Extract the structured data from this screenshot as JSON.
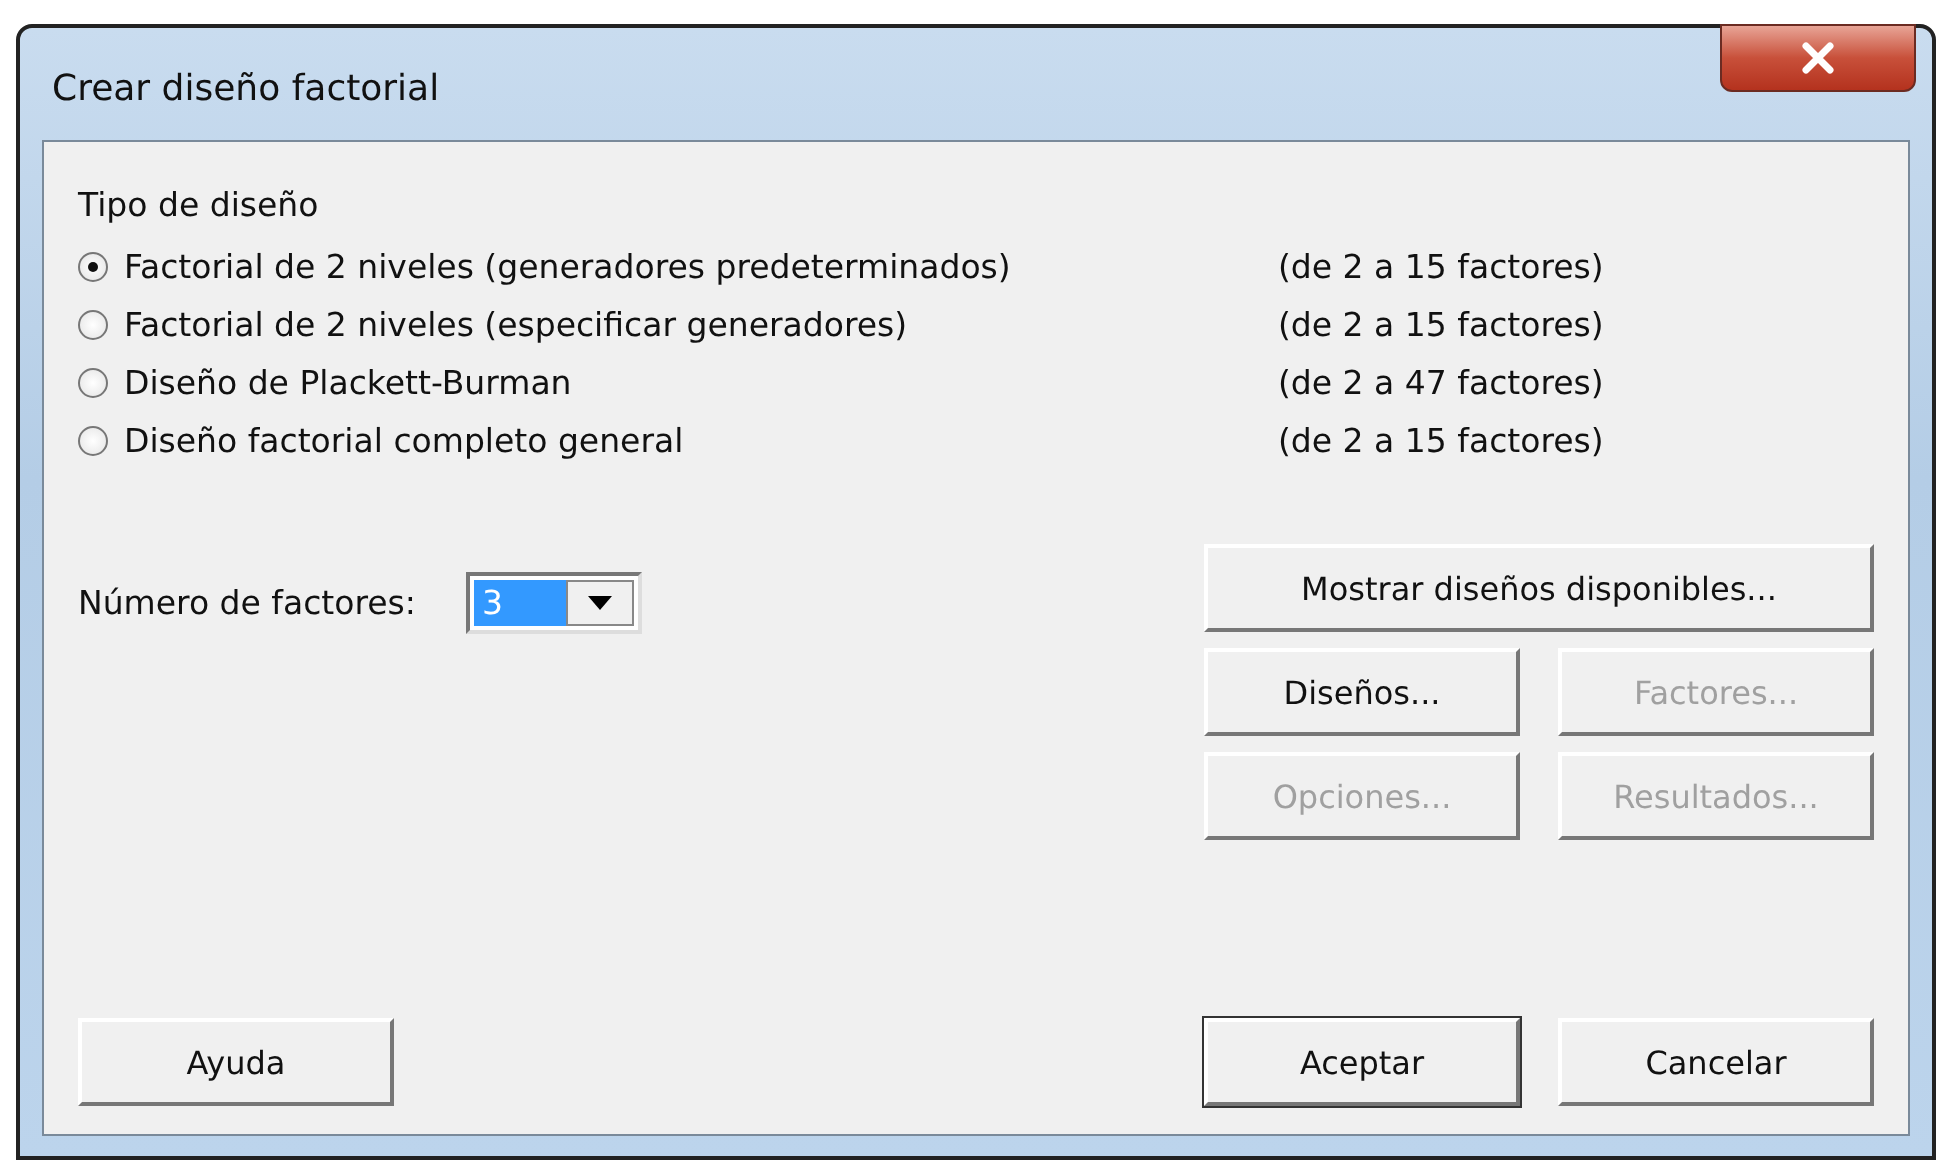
{
  "window": {
    "title": "Crear diseño factorial"
  },
  "design_type": {
    "label": "Tipo de diseño",
    "options": [
      {
        "label": "Factorial de 2 niveles (generadores predeterminados)",
        "range": "(de 2 a 15 factores)",
        "selected": true
      },
      {
        "label": "Factorial de 2 niveles (especificar generadores)",
        "range": "(de 2 a 15 factores)",
        "selected": false
      },
      {
        "label": "Diseño de Plackett-Burman",
        "range": "(de 2 a 47 factores)",
        "selected": false
      },
      {
        "label": "Diseño factorial completo general",
        "range": "(de 2 a 15 factores)",
        "selected": false
      }
    ]
  },
  "factor_count": {
    "label": "Número de factores:",
    "value": "3"
  },
  "side_buttons": [
    {
      "label": "Mostrar diseños disponibles...",
      "kind": "wide",
      "disabled": false
    },
    {
      "label": "Diseños...",
      "kind": "normal",
      "disabled": false
    },
    {
      "label": "Factores...",
      "kind": "normal",
      "disabled": true
    },
    {
      "label": "Opciones...",
      "kind": "normal",
      "disabled": true
    },
    {
      "label": "Resultados...",
      "kind": "normal",
      "disabled": true
    }
  ],
  "help_button": {
    "label": "Ayuda"
  },
  "footer_buttons": [
    {
      "label": "Aceptar",
      "default": true
    },
    {
      "label": "Cancelar",
      "default": false
    }
  ]
}
